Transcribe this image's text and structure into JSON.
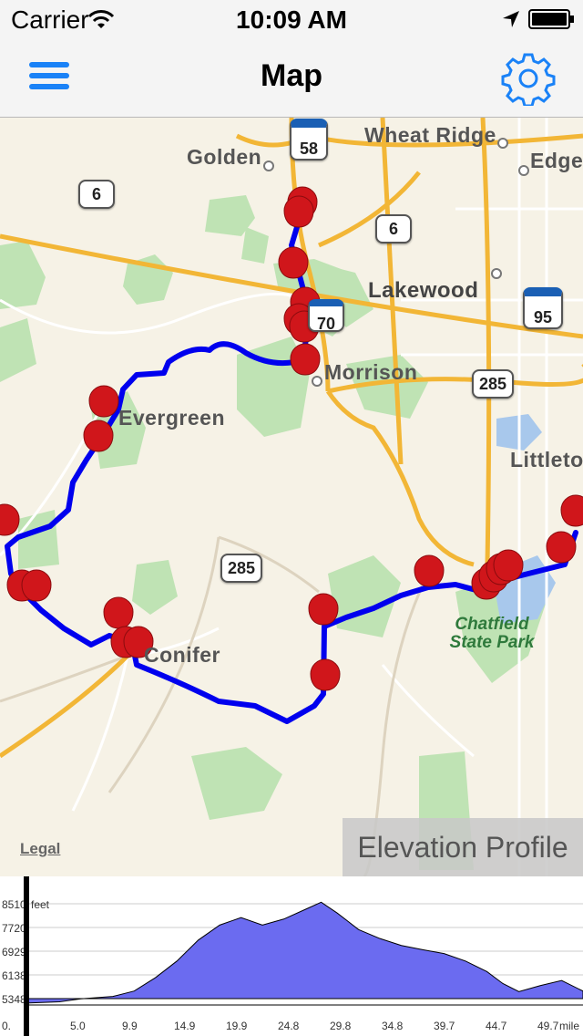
{
  "status_bar": {
    "carrier": "Carrier",
    "time": "10:09 AM"
  },
  "nav": {
    "title": "Map"
  },
  "map": {
    "labels": {
      "golden": "Golden",
      "wheat_ridge": "Wheat Ridge",
      "edge": "Edge",
      "lakewood": "Lakewood",
      "morrison": "Morrison",
      "evergreen": "Evergreen",
      "littleton": "Littleto",
      "conifer": "Conifer",
      "chatfield_park": "Chatfield State Park"
    },
    "shields": {
      "us6_a": "6",
      "us6_b": "6",
      "co58": "58",
      "i70": "70",
      "co95": "95",
      "us285_a": "285",
      "us285_b": "285"
    },
    "legal": "Legal",
    "elevation_button": "Elevation Profile",
    "route_color": "#0000ee",
    "marker_color": "#d0161b"
  },
  "chart_data": {
    "type": "area",
    "y_unit": "feet",
    "x_unit": "mile",
    "yticks": [
      5348,
      6138,
      6929,
      7720,
      8510
    ],
    "xticks": [
      "0.",
      "5.0",
      "9.9",
      "14.9",
      "19.9",
      "24.8",
      "29.8",
      "34.8",
      "39.7",
      "44.7",
      "49.7"
    ],
    "fill_color": "#6b6bf0",
    "x": [
      0,
      3,
      5,
      8,
      10,
      12,
      14,
      16,
      18,
      20,
      22,
      24,
      26,
      27.5,
      29,
      31,
      33,
      35,
      37,
      39,
      41,
      43,
      44.5,
      46,
      48,
      50,
      52
    ],
    "y": [
      5200,
      5240,
      5340,
      5420,
      5600,
      6050,
      6600,
      7300,
      7800,
      8050,
      7800,
      8000,
      8320,
      8560,
      8200,
      7650,
      7350,
      7120,
      6980,
      6850,
      6600,
      6250,
      5850,
      5580,
      5780,
      5950,
      5600
    ]
  }
}
